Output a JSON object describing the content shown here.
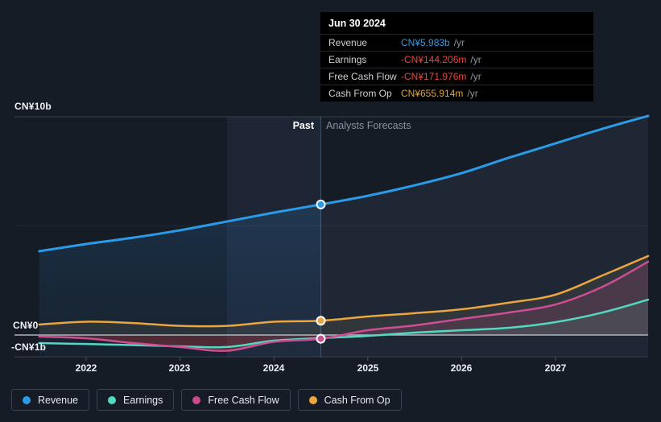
{
  "tooltip": {
    "date": "Jun 30 2024",
    "rows": [
      {
        "label": "Revenue",
        "value": "CN¥5.983b",
        "unit": "/yr",
        "color": "#2e9be4"
      },
      {
        "label": "Earnings",
        "value": "-CN¥144.206m",
        "unit": "/yr",
        "color": "#e8463c"
      },
      {
        "label": "Free Cash Flow",
        "value": "-CN¥171.976m",
        "unit": "/yr",
        "color": "#e8463c"
      },
      {
        "label": "Cash From Op",
        "value": "CN¥655.914m",
        "unit": "/yr",
        "color": "#e2a33d"
      }
    ]
  },
  "sections": {
    "past": "Past",
    "forecast": "Analysts Forecasts"
  },
  "axis": {
    "y_labels": [
      {
        "text": "CN¥10b",
        "value": 10
      },
      {
        "text": "CN¥0",
        "value": 0
      },
      {
        "text": "-CN¥1b",
        "value": -1
      }
    ],
    "x_labels": [
      "2022",
      "2023",
      "2024",
      "2025",
      "2026",
      "2027"
    ]
  },
  "legend": [
    {
      "label": "Revenue",
      "color": "#2b9be8"
    },
    {
      "label": "Earnings",
      "color": "#53d8c1"
    },
    {
      "label": "Free Cash Flow",
      "color": "#c9498c"
    },
    {
      "label": "Cash From Op",
      "color": "#eaa63f"
    }
  ],
  "chart_data": {
    "type": "line",
    "title": "Earnings and Revenue Growth — past results and analyst forecasts",
    "unit": "CN¥ billions per year",
    "x_years": [
      2021.5,
      2022,
      2022.5,
      2023,
      2023.5,
      2024,
      2024.5,
      2025,
      2025.5,
      2026,
      2026.5,
      2027,
      2027.5,
      2028
    ],
    "x_ticks": [
      2022,
      2023,
      2024,
      2025,
      2026,
      2027
    ],
    "y_gridlines": [
      10,
      5,
      0,
      -1
    ],
    "ylim": [
      -1.2,
      10.1
    ],
    "divider_x": 2024.5,
    "highlight_band": [
      2023.5,
      2024.5
    ],
    "legend_position": "bottom",
    "series": [
      {
        "name": "Revenue",
        "color": "#2b9be8",
        "width": 3,
        "marker_at": 2024.5,
        "values": [
          3.84,
          4.17,
          4.46,
          4.8,
          5.2,
          5.61,
          5.983,
          6.38,
          6.86,
          7.42,
          8.12,
          8.78,
          9.45,
          10.04
        ]
      },
      {
        "name": "Earnings",
        "color": "#53d8c1",
        "width": 2.5,
        "marker_at": null,
        "values": [
          -0.37,
          -0.41,
          -0.46,
          -0.52,
          -0.55,
          -0.26,
          -0.144,
          -0.04,
          0.11,
          0.22,
          0.33,
          0.59,
          1.03,
          1.62
        ]
      },
      {
        "name": "Free Cash Flow",
        "color": "#cf4d94",
        "width": 2.5,
        "marker_at": 2024.5,
        "values": [
          -0.07,
          -0.15,
          -0.37,
          -0.55,
          -0.72,
          -0.31,
          -0.172,
          0.22,
          0.44,
          0.74,
          1.03,
          1.4,
          2.21,
          3.36
        ]
      },
      {
        "name": "Cash From Op",
        "color": "#eaa63f",
        "width": 2.5,
        "marker_at": 2024.5,
        "values": [
          0.48,
          0.61,
          0.55,
          0.42,
          0.42,
          0.61,
          0.656,
          0.85,
          1.0,
          1.18,
          1.48,
          1.85,
          2.73,
          3.62
        ]
      }
    ]
  }
}
